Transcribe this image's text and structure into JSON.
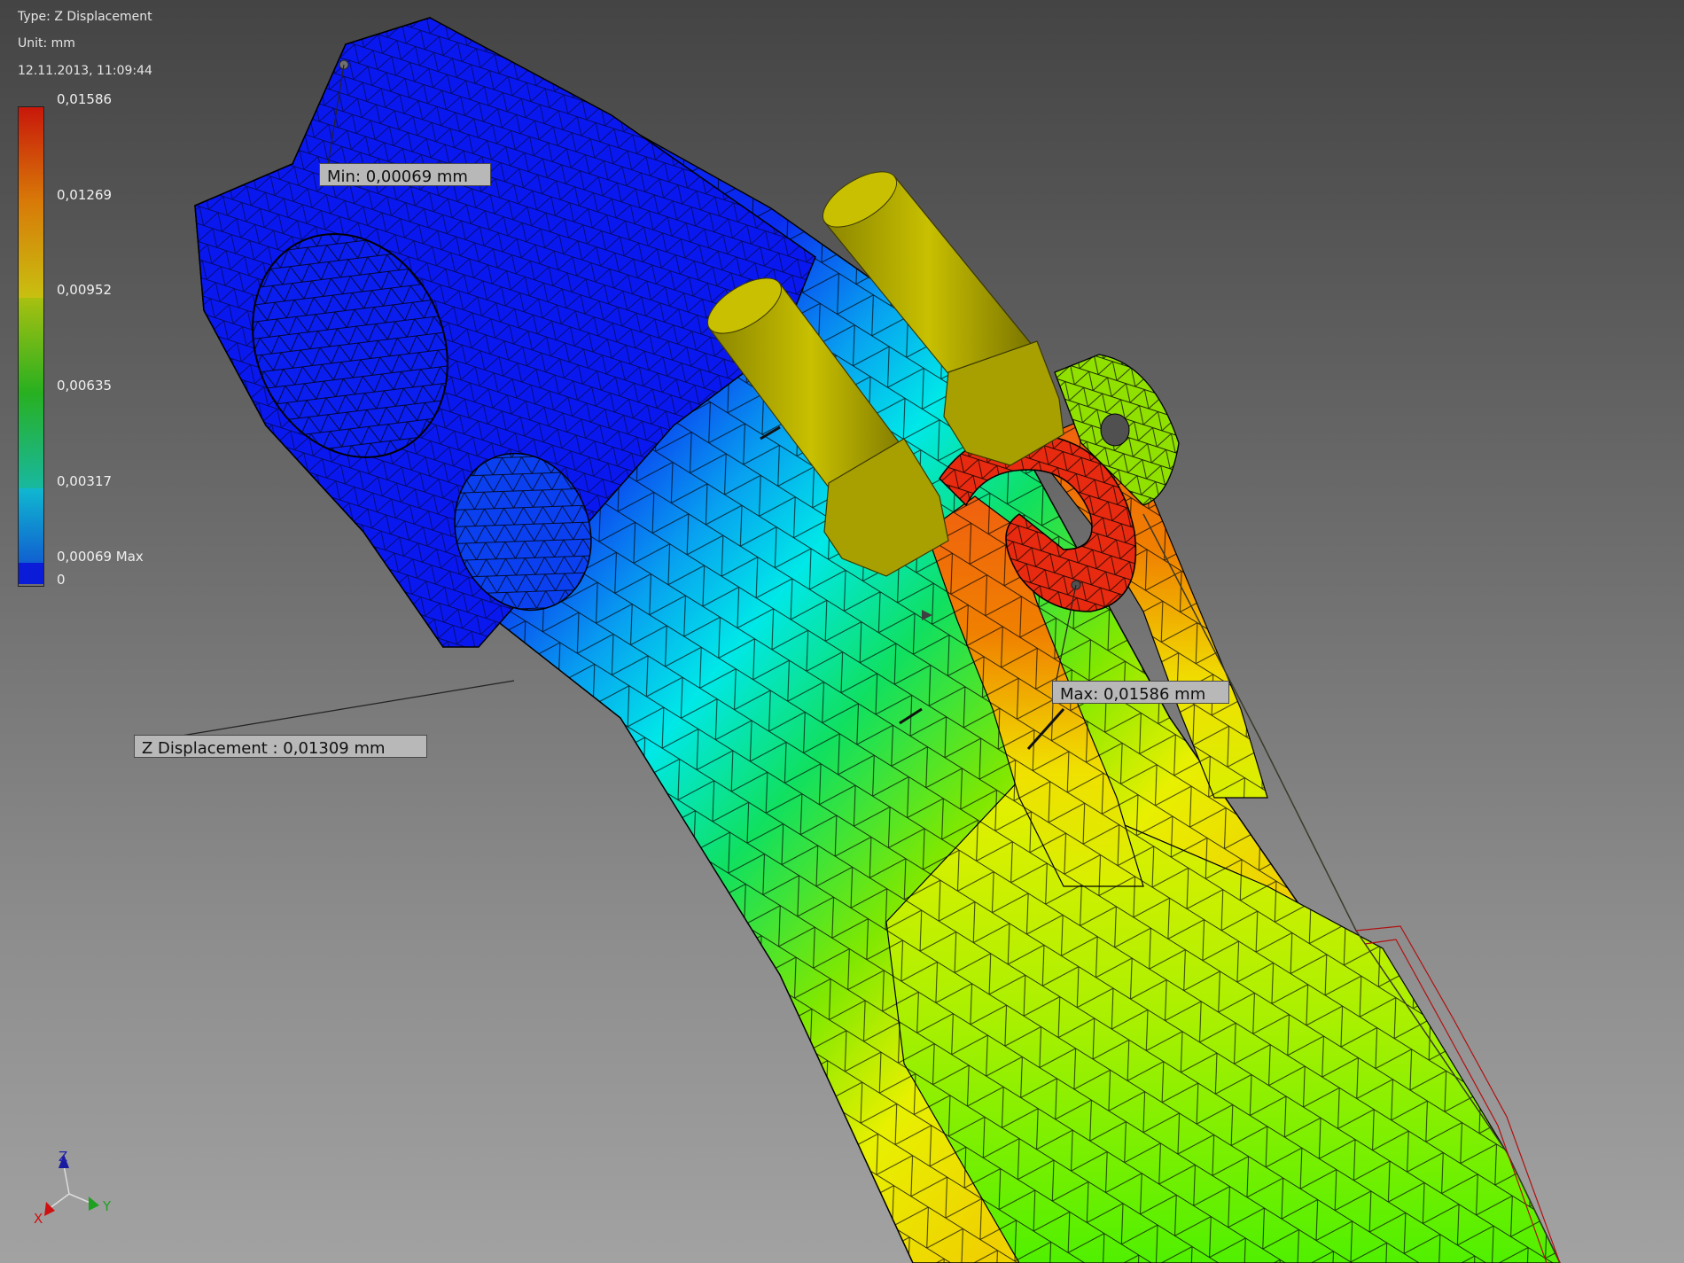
{
  "header": {
    "type_line": "Type: Z Displacement",
    "unit_line": "Unit: mm",
    "datetime": "12.11.2013, 11:09:44"
  },
  "legend": {
    "ticks": [
      "0,01586",
      "0,01269",
      "0,00952",
      "0,00635",
      "0,00317",
      "0,00069 Max",
      "0"
    ],
    "colors": [
      "#c8180a",
      "#d87a08",
      "#c8c010",
      "#28b020",
      "#18b870",
      "#10a8d8",
      "#1060d0",
      "#0a1cd8"
    ]
  },
  "callouts": {
    "min": "Min: 0,00069 mm",
    "max": "Max: 0,01586 mm",
    "probe": "Z Displacement : 0,01309 mm"
  },
  "triad": {
    "x": "X",
    "y": "Y",
    "z": "Z"
  },
  "colors": {
    "background_top": "#444444",
    "background_bottom": "#a2a2a2",
    "min_color": "#0a1cf0",
    "max_color": "#e81a0a",
    "pin_color": "#b8b000"
  }
}
